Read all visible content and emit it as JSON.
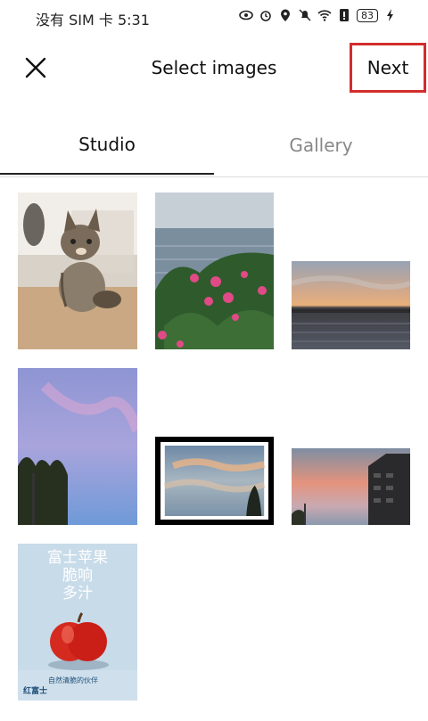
{
  "status": {
    "carrier": "没有 SIM 卡",
    "time": "5:31",
    "battery": "83"
  },
  "appbar": {
    "title": "Select images",
    "next_label": "Next"
  },
  "tabs": [
    {
      "label": "Studio",
      "selected": true
    },
    {
      "label": "Gallery",
      "selected": false
    }
  ],
  "poster": {
    "title_line1": "富士苹果",
    "title_line2": "脆响",
    "title_line3": "多汁",
    "tagline": "自然清脆的伙伴",
    "footer_left": "红富士"
  },
  "grid": {
    "images": [
      {
        "name": "kitten"
      },
      {
        "name": "lake-and-flowers"
      },
      {
        "name": "lake-sunset"
      },
      {
        "name": "pink-sky-trees"
      },
      {
        "name": "sunset-clouds-selected",
        "selected": true
      },
      {
        "name": "sunset-building"
      },
      {
        "name": "apple-poster"
      }
    ]
  }
}
